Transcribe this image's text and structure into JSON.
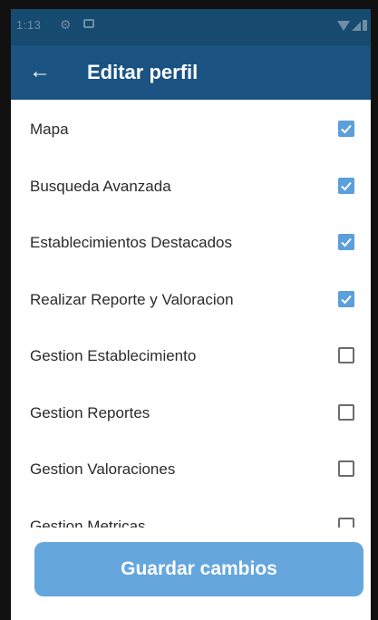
{
  "status_bar": {
    "time": "1:13",
    "icons": [
      "gear-icon",
      "photo-icon",
      "wifi-icon",
      "signal-icon",
      "battery-icon"
    ]
  },
  "app_bar": {
    "back_icon": "arrow-left-icon",
    "title": "Editar perfil"
  },
  "permissions": [
    {
      "label": "Mapa",
      "checked": true
    },
    {
      "label": "Busqueda Avanzada",
      "checked": true
    },
    {
      "label": "Establecimientos Destacados",
      "checked": true
    },
    {
      "label": "Realizar Reporte y Valoracion",
      "checked": true
    },
    {
      "label": "Gestion Establecimiento",
      "checked": false
    },
    {
      "label": "Gestion Reportes",
      "checked": false
    },
    {
      "label": "Gestion Valoraciones",
      "checked": false
    },
    {
      "label": "Gestion Metricas",
      "checked": false
    }
  ],
  "save_button": {
    "label": "Guardar cambios"
  },
  "colors": {
    "status_bar": "#164a6e",
    "app_bar": "#1a5382",
    "checkbox_checked": "#5b9fdb",
    "button": "#65a7dc"
  }
}
